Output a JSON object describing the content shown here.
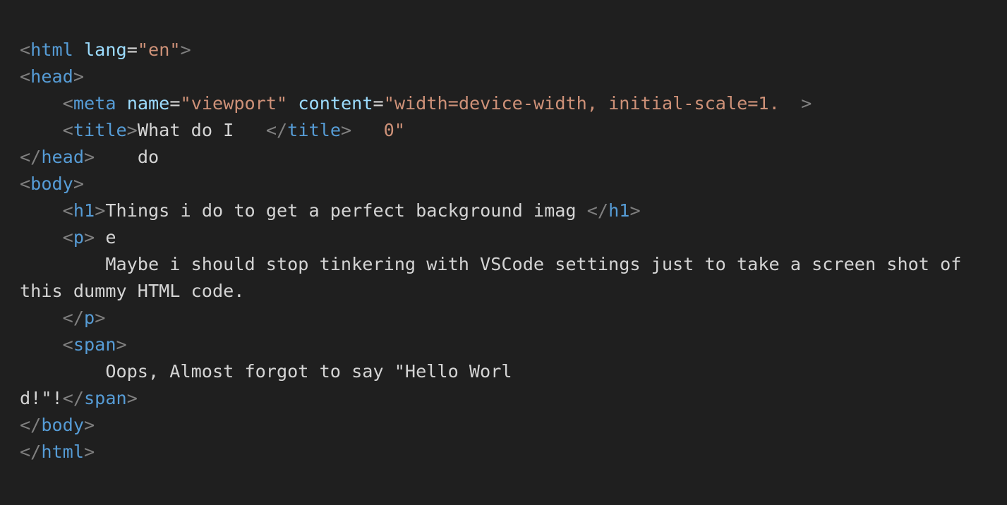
{
  "editor": {
    "theme": {
      "background": "#1f1f1f",
      "punctuation": "#808080",
      "tag": "#569cd6",
      "attribute": "#9cdcfe",
      "string": "#ce9178",
      "text": "#d4d4d4"
    },
    "lines": [
      {
        "name": "line-html-open",
        "tokens": [
          {
            "k": "p",
            "v": "<"
          },
          {
            "k": "t",
            "v": "html"
          },
          {
            "k": "x",
            "v": " "
          },
          {
            "k": "a",
            "v": "lang"
          },
          {
            "k": "o",
            "v": "="
          },
          {
            "k": "s",
            "v": "\"en\""
          },
          {
            "k": "p",
            "v": ">"
          }
        ]
      },
      {
        "name": "line-head-open",
        "tokens": [
          {
            "k": "p",
            "v": "<"
          },
          {
            "k": "t",
            "v": "head"
          },
          {
            "k": "p",
            "v": ">"
          }
        ]
      },
      {
        "name": "line-meta",
        "tokens": [
          {
            "k": "x",
            "v": "    "
          },
          {
            "k": "p",
            "v": "<"
          },
          {
            "k": "t",
            "v": "meta"
          },
          {
            "k": "x",
            "v": " "
          },
          {
            "k": "a",
            "v": "name"
          },
          {
            "k": "o",
            "v": "="
          },
          {
            "k": "s",
            "v": "\"viewport\""
          },
          {
            "k": "x",
            "v": " "
          },
          {
            "k": "a",
            "v": "content"
          },
          {
            "k": "o",
            "v": "="
          },
          {
            "k": "s",
            "v": "\"width=device-width, initial-scale=1."
          },
          {
            "k": "x",
            "v": "  "
          },
          {
            "k": "p",
            "v": ">"
          }
        ]
      },
      {
        "name": "line-title",
        "tokens": [
          {
            "k": "x",
            "v": "    "
          },
          {
            "k": "p",
            "v": "<"
          },
          {
            "k": "t",
            "v": "title"
          },
          {
            "k": "p",
            "v": ">"
          },
          {
            "k": "x",
            "v": "What do I   "
          },
          {
            "k": "p",
            "v": "</"
          },
          {
            "k": "t",
            "v": "title"
          },
          {
            "k": "p",
            "v": ">"
          },
          {
            "k": "x",
            "v": "   "
          },
          {
            "k": "s",
            "v": "0\""
          }
        ]
      },
      {
        "name": "line-head-close",
        "tokens": [
          {
            "k": "p",
            "v": "</"
          },
          {
            "k": "t",
            "v": "head"
          },
          {
            "k": "p",
            "v": ">"
          },
          {
            "k": "x",
            "v": "    do"
          }
        ]
      },
      {
        "name": "line-body-open",
        "tokens": [
          {
            "k": "p",
            "v": "<"
          },
          {
            "k": "t",
            "v": "body"
          },
          {
            "k": "p",
            "v": ">"
          }
        ]
      },
      {
        "name": "line-h1",
        "tokens": [
          {
            "k": "x",
            "v": "    "
          },
          {
            "k": "p",
            "v": "<"
          },
          {
            "k": "t",
            "v": "h1"
          },
          {
            "k": "p",
            "v": ">"
          },
          {
            "k": "x",
            "v": "Things i do to get a perfect background imag "
          },
          {
            "k": "p",
            "v": "</"
          },
          {
            "k": "t",
            "v": "h1"
          },
          {
            "k": "p",
            "v": ">"
          }
        ]
      },
      {
        "name": "line-p-open",
        "tokens": [
          {
            "k": "x",
            "v": "    "
          },
          {
            "k": "p",
            "v": "<"
          },
          {
            "k": "t",
            "v": "p"
          },
          {
            "k": "p",
            "v": ">"
          },
          {
            "k": "x",
            "v": " e"
          }
        ]
      },
      {
        "name": "line-p-text-1",
        "tokens": [
          {
            "k": "x",
            "v": "        Maybe i should stop tinkering with VSCode settings just to take a screen shot of"
          }
        ]
      },
      {
        "name": "line-p-text-2",
        "tokens": [
          {
            "k": "x",
            "v": "this dummy HTML code."
          }
        ]
      },
      {
        "name": "line-p-close",
        "tokens": [
          {
            "k": "x",
            "v": "    "
          },
          {
            "k": "p",
            "v": "</"
          },
          {
            "k": "t",
            "v": "p"
          },
          {
            "k": "p",
            "v": ">"
          }
        ]
      },
      {
        "name": "line-span-open",
        "tokens": [
          {
            "k": "x",
            "v": "    "
          },
          {
            "k": "p",
            "v": "<"
          },
          {
            "k": "t",
            "v": "span"
          },
          {
            "k": "p",
            "v": ">"
          }
        ]
      },
      {
        "name": "line-span-text-1",
        "tokens": [
          {
            "k": "x",
            "v": "        Oops, Almost forgot to say \"Hello Worl"
          }
        ]
      },
      {
        "name": "line-span-text-2",
        "tokens": [
          {
            "k": "x",
            "v": "d!\"!"
          },
          {
            "k": "p",
            "v": "</"
          },
          {
            "k": "t",
            "v": "span"
          },
          {
            "k": "p",
            "v": ">"
          }
        ]
      },
      {
        "name": "line-body-close",
        "tokens": [
          {
            "k": "p",
            "v": "</"
          },
          {
            "k": "t",
            "v": "body"
          },
          {
            "k": "p",
            "v": ">"
          }
        ]
      },
      {
        "name": "line-html-close",
        "tokens": [
          {
            "k": "p",
            "v": "</"
          },
          {
            "k": "t",
            "v": "html"
          },
          {
            "k": "p",
            "v": ">"
          }
        ]
      }
    ]
  }
}
